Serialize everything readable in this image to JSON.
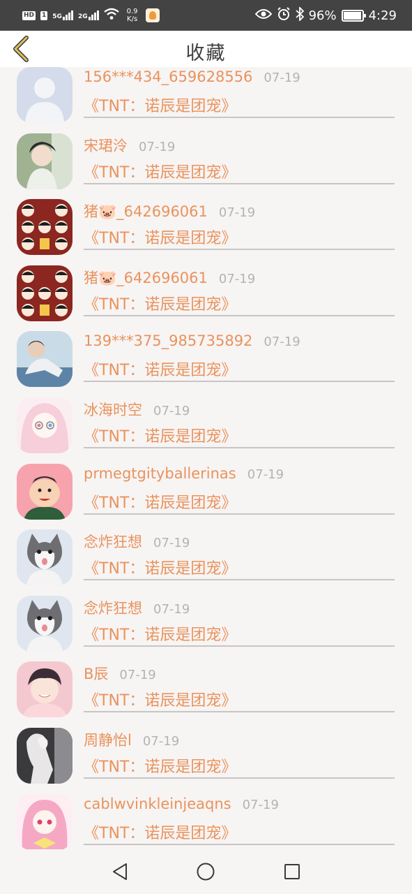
{
  "status_bar": {
    "hd": "HD",
    "sim": "1",
    "net_5g": "5G",
    "net_2g": "2G",
    "speed": "0.9",
    "speed_unit": "K/s",
    "battery": "96%",
    "time": "4:29"
  },
  "header": {
    "title": "收藏",
    "back_icon": "chevron-left-icon",
    "accent": "#d7b640"
  },
  "colors": {
    "name": "#e9935c",
    "date": "#b6b2b2",
    "divider": "#c9c5c5"
  },
  "items": [
    {
      "name": "156***434_659628556",
      "date": "07-19",
      "book": "《TNT：诺辰是团宠》",
      "avatar": "default-avatar"
    },
    {
      "name": "宋珺泠",
      "date": "07-19",
      "book": "《TNT：诺辰是团宠》",
      "avatar": "girl-portrait"
    },
    {
      "name": "猪🐷_642696061",
      "date": "07-19",
      "book": "《TNT：诺辰是团宠》",
      "avatar": "tnt-stickers"
    },
    {
      "name": "猪🐷_642696061",
      "date": "07-19",
      "book": "《TNT：诺辰是团宠》",
      "avatar": "tnt-stickers"
    },
    {
      "name": "139***375_985735892",
      "date": "07-19",
      "book": "《TNT：诺辰是团宠》",
      "avatar": "boy-photo"
    },
    {
      "name": "冰海时空",
      "date": "07-19",
      "book": "《TNT：诺辰是团宠》",
      "avatar": "anime-girl-pink"
    },
    {
      "name": "prmegtgityballerinas",
      "date": "07-19",
      "book": "《TNT：诺辰是团宠》",
      "avatar": "cartoon-man"
    },
    {
      "name": "念炸狂想",
      "date": "07-19",
      "book": "《TNT：诺辰是团宠》",
      "avatar": "cat"
    },
    {
      "name": "念炸狂想",
      "date": "07-19",
      "book": "《TNT：诺辰是团宠》",
      "avatar": "cat"
    },
    {
      "name": "B辰",
      "date": "07-19",
      "book": "《TNT：诺辰是团宠》",
      "avatar": "anime-boy"
    },
    {
      "name": "周静怡l",
      "date": "07-19",
      "book": "《TNT：诺辰是团宠》",
      "avatar": "girl-silhouette"
    },
    {
      "name": "cablwvinkleinjeaqns",
      "date": "07-19",
      "book": "《TNT：诺辰是团宠》",
      "avatar": "anime-girl-pink-hair"
    }
  ],
  "nav": {
    "back": "triangle-back-icon",
    "home": "circle-home-icon",
    "recent": "square-recents-icon"
  }
}
